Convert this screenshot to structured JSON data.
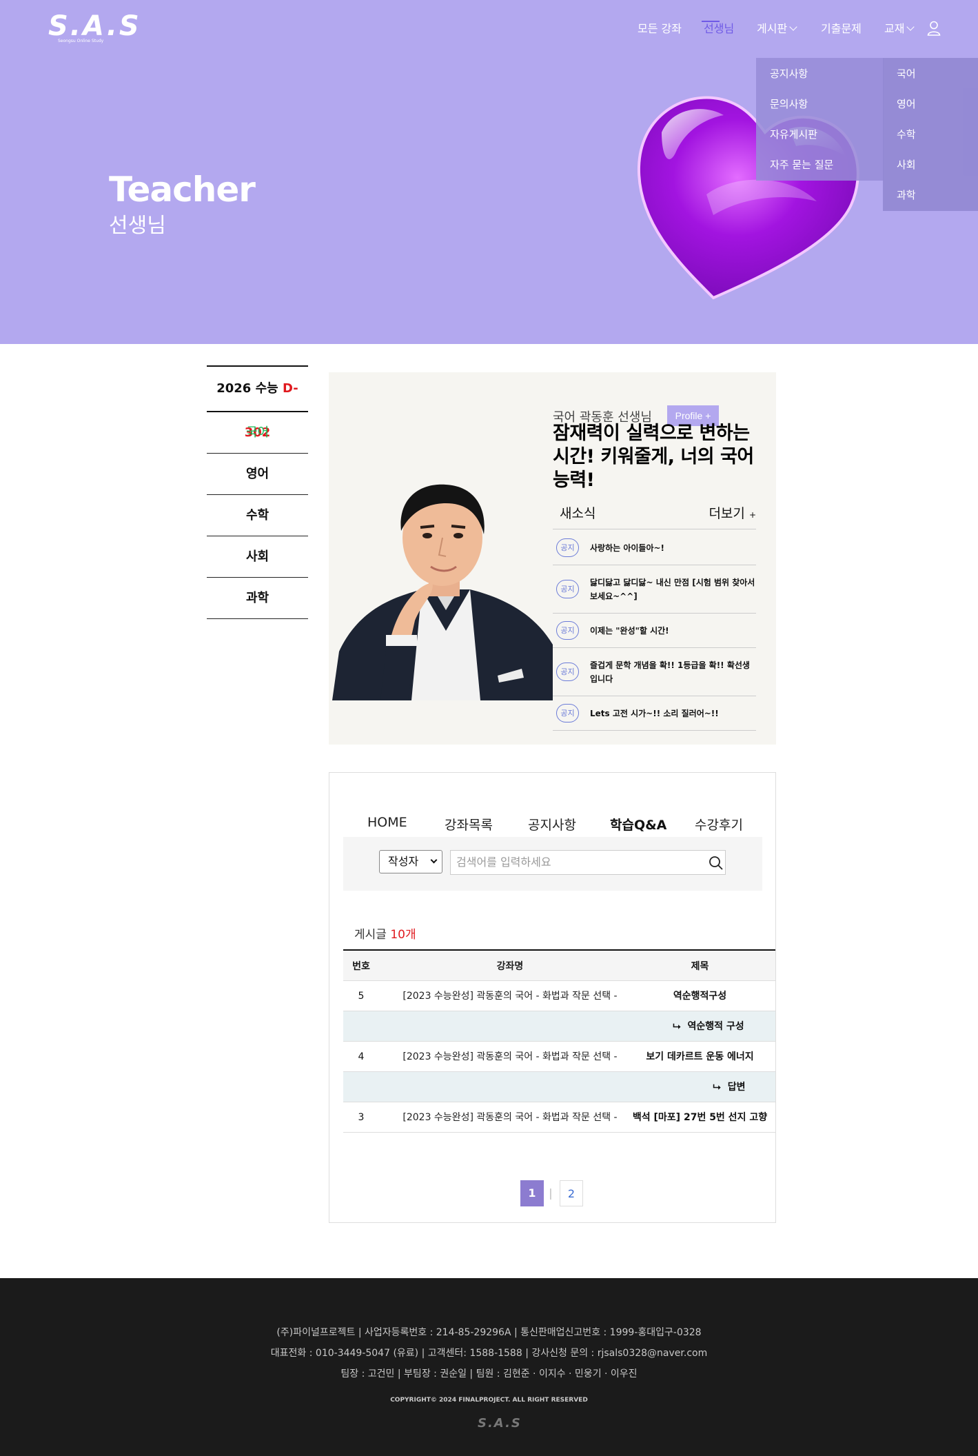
{
  "brand": {
    "logo": "S.A.S",
    "logo_sub": "Seongsu Online Study"
  },
  "nav": {
    "items": [
      "모든 강좌",
      "선생님",
      "게시판",
      "기출문제",
      "교재"
    ],
    "active": "선생님",
    "board_dropdown": [
      "공지사항",
      "문의사항",
      "자유게시판",
      "자주 묻는 질문"
    ],
    "book_dropdown": [
      "국어",
      "영어",
      "수학",
      "사회",
      "과학"
    ]
  },
  "hero": {
    "title": "Teacher",
    "subtitle": "선생님"
  },
  "sidebar": {
    "dday_label": "2026 수능",
    "dday_value": "D-302",
    "items": [
      "국어",
      "영어",
      "수학",
      "사회",
      "과학"
    ],
    "active": "국어"
  },
  "profile": {
    "teacher": "국어 곽동훈 선생님",
    "profile_button": "Profile +",
    "slogan": "잠재력이 실력으로 변하는 시간! 키워줄게, 너의 국어 능력!",
    "news_title": "새소식",
    "news_more": "더보기",
    "news_more_plus": "+",
    "news": [
      {
        "badge": "공지",
        "text": "사랑하는 아이들아~!"
      },
      {
        "badge": "공지",
        "text": "닳디닳고 닳디닳~ 내신 만점 [시험 범위 찾아서 보세요~^^]"
      },
      {
        "badge": "공지",
        "text": "이제는 \"완성\"할 시간!"
      },
      {
        "badge": "공지",
        "text": "즐겁게 문학 개념을 확!! 1등급을 확!! 확선생입니다"
      },
      {
        "badge": "공지",
        "text": "Lets 고전 시가~!! 소리 질러어~!!"
      }
    ]
  },
  "board": {
    "tabs": [
      "HOME",
      "강좌목록",
      "공지사항",
      "학습Q&A",
      "수강후기"
    ],
    "active_tab": "학습Q&A",
    "search_field": "작성자",
    "search_placeholder": "검색어를 입력하세요",
    "count_label": "게시글",
    "count_value": "10개",
    "columns": [
      "번호",
      "강좌명",
      "제목"
    ],
    "rows": [
      {
        "no": "5",
        "course": "[2023 수능완성] 곽동훈의 국어 - 화법과 작문 선택 -",
        "title": "역순행적구성",
        "reply": false
      },
      {
        "no": "",
        "course": "",
        "title": "역순행적 구성",
        "reply": true
      },
      {
        "no": "4",
        "course": "[2023 수능완성] 곽동훈의 국어 - 화법과 작문 선택 -",
        "title": "보기 데카르트 운동 에너지",
        "reply": false
      },
      {
        "no": "",
        "course": "",
        "title": "답변",
        "reply": true
      },
      {
        "no": "3",
        "course": "[2023 수능완성] 곽동훈의 국어 - 화법과 작문 선택 -",
        "title": "백석 [마포] 27번 5번 선지 고향",
        "reply": false
      }
    ],
    "reply_arrow": "⮡",
    "pages": [
      "1",
      "2"
    ],
    "page_sep": "|",
    "current_page": "1"
  },
  "footer": {
    "line1": "(주)파이널프로젝트 | 사업자등록번호 : 214-85-29296A | 통신판매업신고번호 : 1999-홍대입구-0328",
    "line2": "대표전화 : 010-3449-5047 (유료) | 고객센터: 1588-1588 | 강사신청 문의 : rjsals0328@naver.com",
    "line3": "팀장 : 고건민  |  부팀장 : 권순일  |  팀원 : 김현준 · 이지수 · 민웅기 · 이우진",
    "copyright": "COPYRIGHT© 2024 FINALPROJECT. ALL RIGHT RESERVED",
    "logo": "S.A.S"
  },
  "colors": {
    "hero_bg": "#b3a8ef",
    "nav_active": "#6f5ae6",
    "dday": "#e0191e",
    "side_active": "#16b754",
    "badge": "#6b7bd8",
    "page_current": "#8c7cd0",
    "footer_bg": "#1b1b1b"
  },
  "icons": [
    "user-icon",
    "search-icon",
    "heart-image",
    "chevron-down-icon"
  ]
}
